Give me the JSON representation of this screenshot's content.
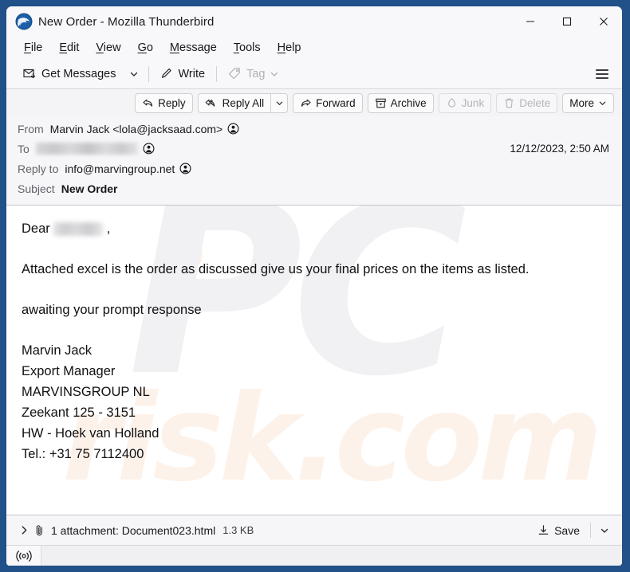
{
  "window": {
    "title": "New Order - Mozilla Thunderbird",
    "app_icon": "thunderbird-logo",
    "controls": {
      "minimize": "minimize-icon",
      "maximize": "maximize-icon",
      "close": "close-icon"
    },
    "frame_color": "#225089"
  },
  "menubar": {
    "items": [
      {
        "label": "File",
        "mnemonic": "F"
      },
      {
        "label": "Edit",
        "mnemonic": "E"
      },
      {
        "label": "View",
        "mnemonic": "V"
      },
      {
        "label": "Go",
        "mnemonic": "G"
      },
      {
        "label": "Message",
        "mnemonic": "M"
      },
      {
        "label": "Tools",
        "mnemonic": "T"
      },
      {
        "label": "Help",
        "mnemonic": "H"
      }
    ]
  },
  "toolbar": {
    "get_messages": "Get Messages",
    "write": "Write",
    "tag": "Tag",
    "tag_disabled": true,
    "menu_button": "app-menu"
  },
  "message_actions": [
    {
      "label": "Reply",
      "icon": "reply-icon",
      "disabled": false,
      "split": false
    },
    {
      "label": "Reply All",
      "icon": "reply-all-icon",
      "disabled": false,
      "split": true
    },
    {
      "label": "Forward",
      "icon": "forward-icon",
      "disabled": false,
      "split": false
    },
    {
      "label": "Archive",
      "icon": "archive-icon",
      "disabled": false,
      "split": false
    },
    {
      "label": "Junk",
      "icon": "junk-icon",
      "disabled": true,
      "split": false
    },
    {
      "label": "Delete",
      "icon": "trash-icon",
      "disabled": true,
      "split": false
    },
    {
      "label": "More",
      "icon": "chevron-down-icon",
      "disabled": false,
      "split": false
    }
  ],
  "headers": {
    "from_label": "From",
    "from_value": "Marvin Jack <lola@jacksaad.com>",
    "to_label": "To",
    "to_value": "",
    "to_redacted": true,
    "reply_to_label": "Reply to",
    "reply_to_value": "info@marvingroup.net",
    "subject_label": "Subject",
    "subject_value": "New Order",
    "date": "12/12/2023, 2:50 AM"
  },
  "body": {
    "greeting_prefix": "Dear",
    "greeting_name_redacted": true,
    "greeting_suffix": ",",
    "paragraphs": [
      "Attached excel is the order as discussed give us your final prices on the items as listed.",
      "awaiting your prompt response"
    ],
    "signature": [
      "Marvin Jack",
      "Export Manager",
      "MARVINSGROUP NL",
      "Zeekant 125 - 3151",
      "HW - Hoek van Holland",
      "Tel.: +31 75 7112400"
    ],
    "watermark_primary": "PC",
    "watermark_secondary": "risk.com"
  },
  "attachment": {
    "expand_icon": "chevron-right-icon",
    "clip_icon": "paperclip-icon",
    "summary": "1 attachment: Document023.html",
    "size": "1.3 KB",
    "save_label": "Save",
    "save_icon": "download-icon",
    "more_icon": "chevron-down-icon"
  },
  "statusbar": {
    "connection_icon": "online-status-icon",
    "text": ""
  }
}
